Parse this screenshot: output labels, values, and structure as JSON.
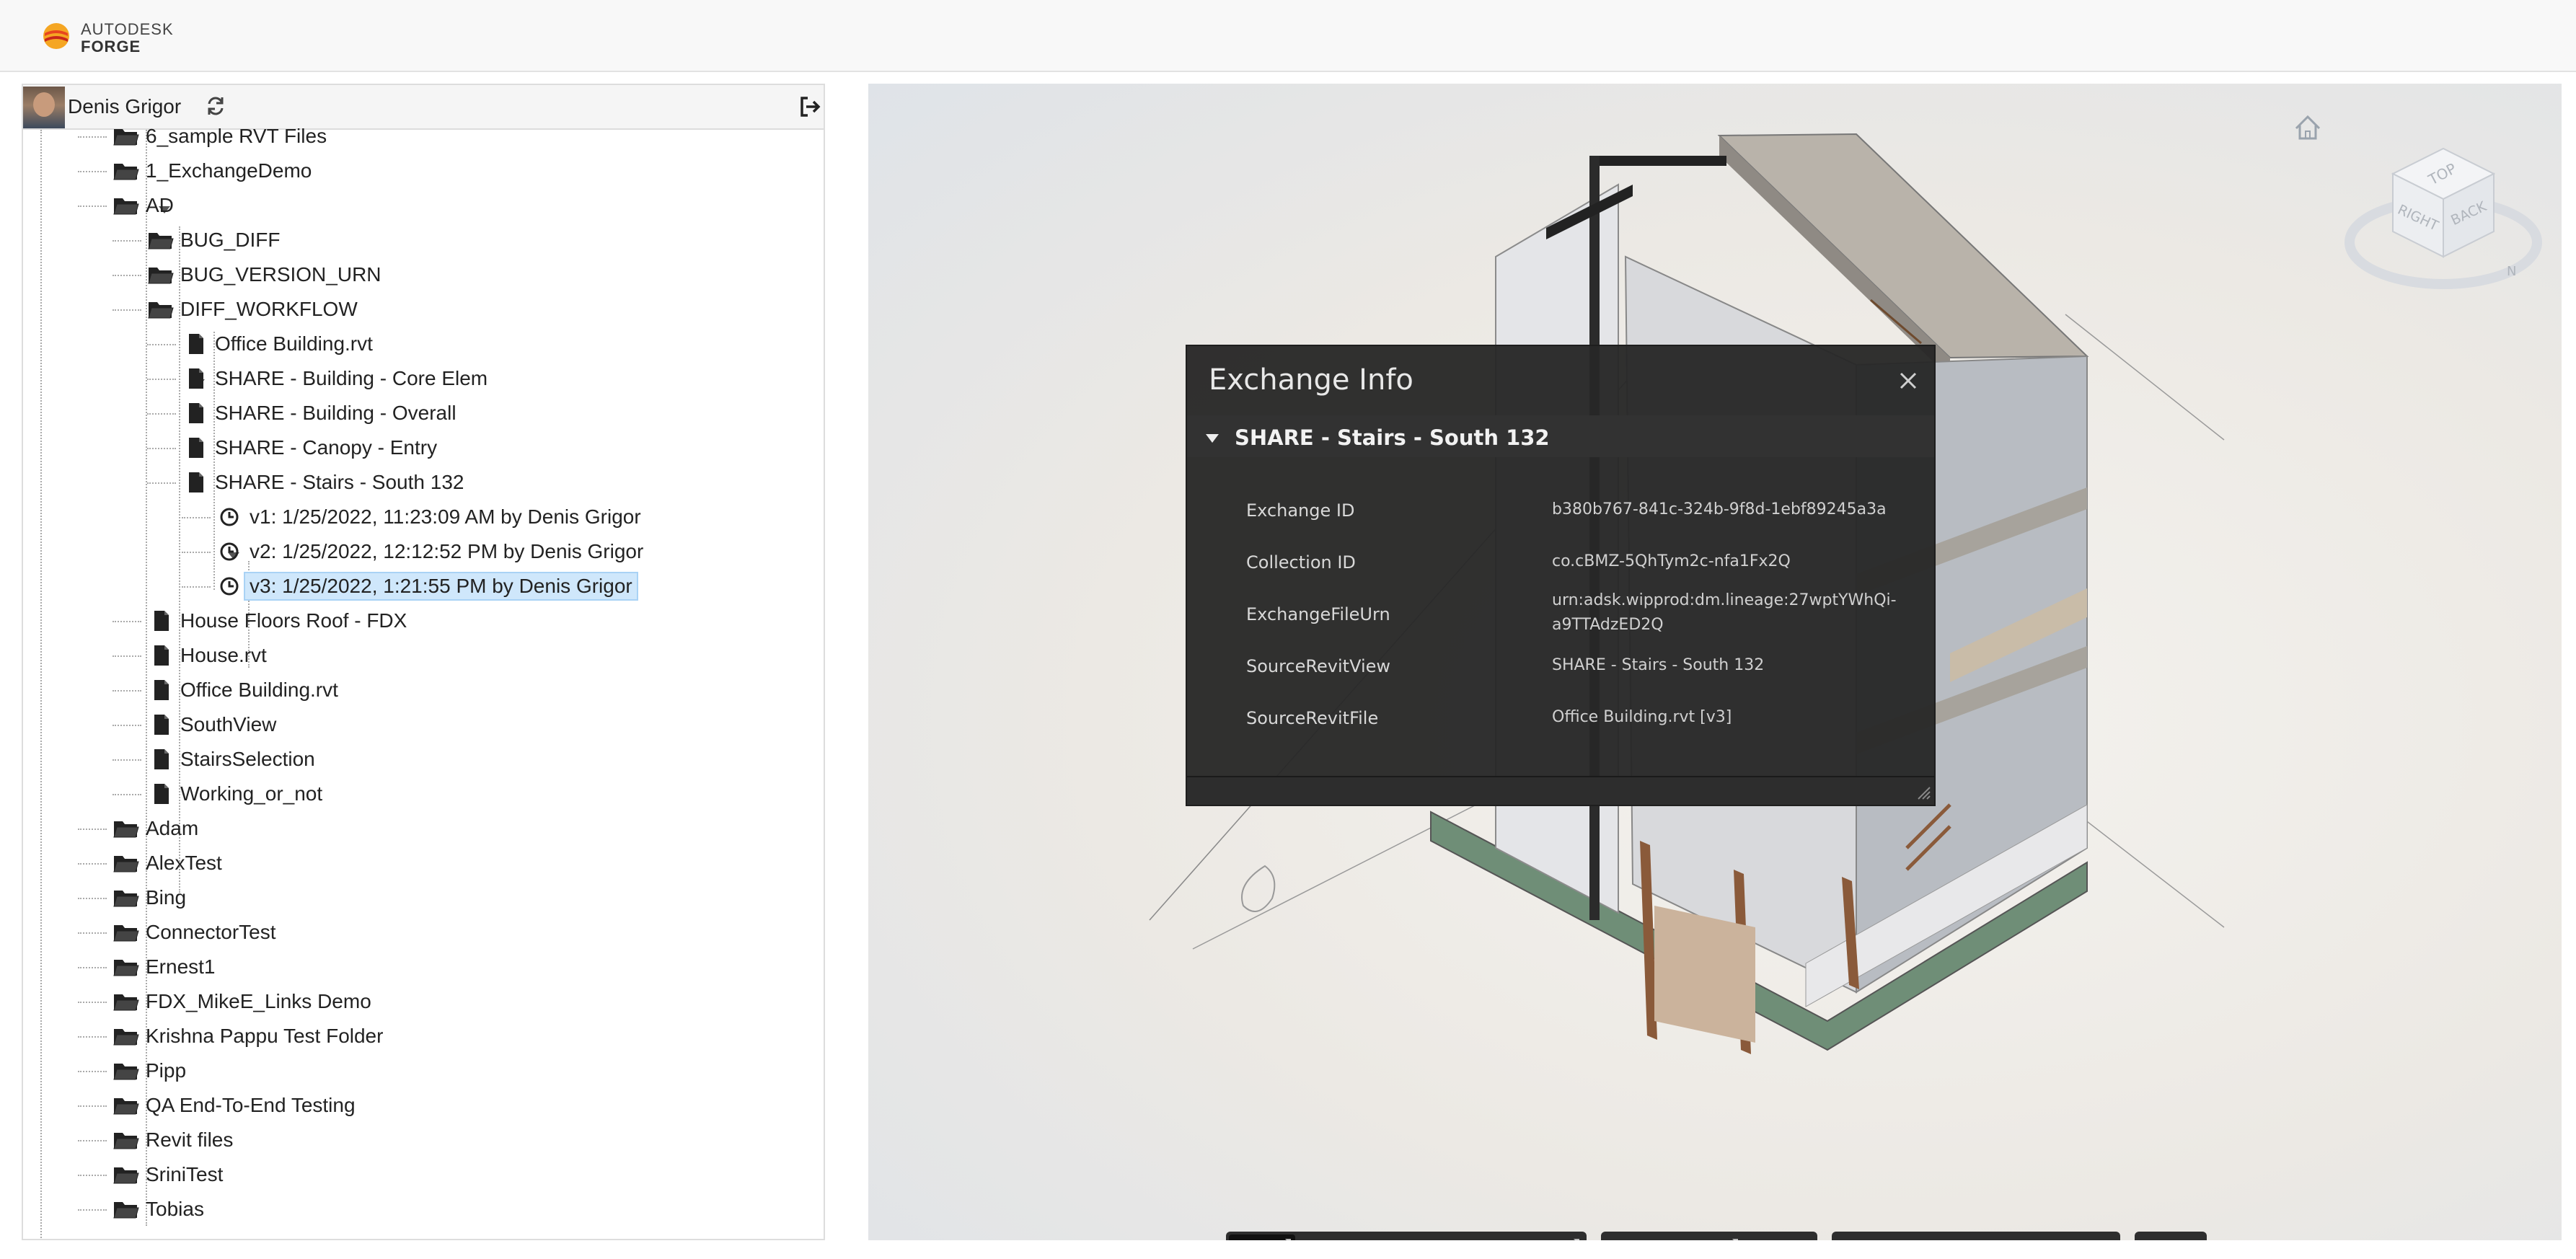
{
  "brand": {
    "line1": "AUTODESK",
    "line2": "FORGE"
  },
  "user": {
    "name": "Denis Grigor"
  },
  "tree": {
    "nodes": [
      {
        "label": "6_sample RVT Files",
        "type": "folder"
      },
      {
        "label": "1_ExchangeDemo",
        "type": "folder"
      },
      {
        "label": "AD",
        "type": "folder"
      },
      {
        "label": "BUG_DIFF",
        "type": "folder"
      },
      {
        "label": "BUG_VERSION_URN",
        "type": "folder"
      },
      {
        "label": "DIFF_WORKFLOW",
        "type": "folder"
      },
      {
        "label": "Office Building.rvt",
        "type": "file"
      },
      {
        "label": "SHARE - Building - Core Elem",
        "type": "file"
      },
      {
        "label": "SHARE - Building - Overall",
        "type": "file"
      },
      {
        "label": "SHARE - Canopy - Entry",
        "type": "file"
      },
      {
        "label": "SHARE - Stairs - South 132",
        "type": "file"
      },
      {
        "label": "v1: 1/25/2022, 11:23:09 AM by Denis Grigor",
        "type": "version"
      },
      {
        "label": "v2: 1/25/2022, 12:12:52 PM by Denis Grigor",
        "type": "version"
      },
      {
        "label": "v3: 1/25/2022, 1:21:55 PM by Denis Grigor",
        "type": "version",
        "selected": true
      },
      {
        "label": "House Floors Roof - FDX",
        "type": "file"
      },
      {
        "label": "House.rvt",
        "type": "file"
      },
      {
        "label": "Office Building.rvt",
        "type": "file"
      },
      {
        "label": "SouthView",
        "type": "file"
      },
      {
        "label": "StairsSelection",
        "type": "file"
      },
      {
        "label": "Working_or_not",
        "type": "file"
      },
      {
        "label": "Adam",
        "type": "folder"
      },
      {
        "label": "AlexTest",
        "type": "folder"
      },
      {
        "label": "Bing",
        "type": "folder"
      },
      {
        "label": "ConnectorTest",
        "type": "folder"
      },
      {
        "label": "Ernest1",
        "type": "folder"
      },
      {
        "label": "FDX_MikeE_Links Demo",
        "type": "folder"
      },
      {
        "label": "Krishna Pappu Test Folder",
        "type": "folder"
      },
      {
        "label": "Pipp",
        "type": "folder"
      },
      {
        "label": "QA End-To-End Testing",
        "type": "folder"
      },
      {
        "label": "Revit files",
        "type": "folder"
      },
      {
        "label": "SriniTest",
        "type": "folder"
      },
      {
        "label": "Tobias",
        "type": "folder"
      }
    ]
  },
  "exchange": {
    "title": "Exchange Info",
    "name": "SHARE - Stairs - South 132",
    "props": [
      {
        "label": "Exchange ID",
        "value": "b380b767-841c-324b-9f8d-1ebf89245a3a"
      },
      {
        "label": "Collection ID",
        "value": "co.cBMZ-5QhTym2c-nfa1Fx2Q"
      },
      {
        "label": "ExchangeFileUrn",
        "value": "urn:adsk.wipprod:dm.lineage:27wptYWhQi-a9TTAdzED2Q"
      },
      {
        "label": "SourceRevitView",
        "value": "SHARE - Stairs - South 132"
      },
      {
        "label": "SourceRevitFile",
        "value": "Office Building.rvt [v3]"
      }
    ]
  },
  "viewcube": {
    "top": "TOP",
    "right": "RIGHT",
    "back": "BACK",
    "north": "N"
  },
  "toolbar": {
    "groups": [
      [
        "orbit-icon",
        "pan-icon",
        "zoom-icon",
        "first-person-icon",
        "camera-icon"
      ],
      [
        "measure-icon",
        "section-icon",
        "explode-icon"
      ],
      [
        "model-browser-icon",
        "properties-icon",
        "settings-icon",
        "fullscreen-icon"
      ],
      [
        "extension-icon"
      ]
    ],
    "active": "orbit-icon"
  },
  "colors": {
    "accent": "#4aa3e0",
    "panel": "#282828",
    "selection": "#cfe7fb"
  }
}
